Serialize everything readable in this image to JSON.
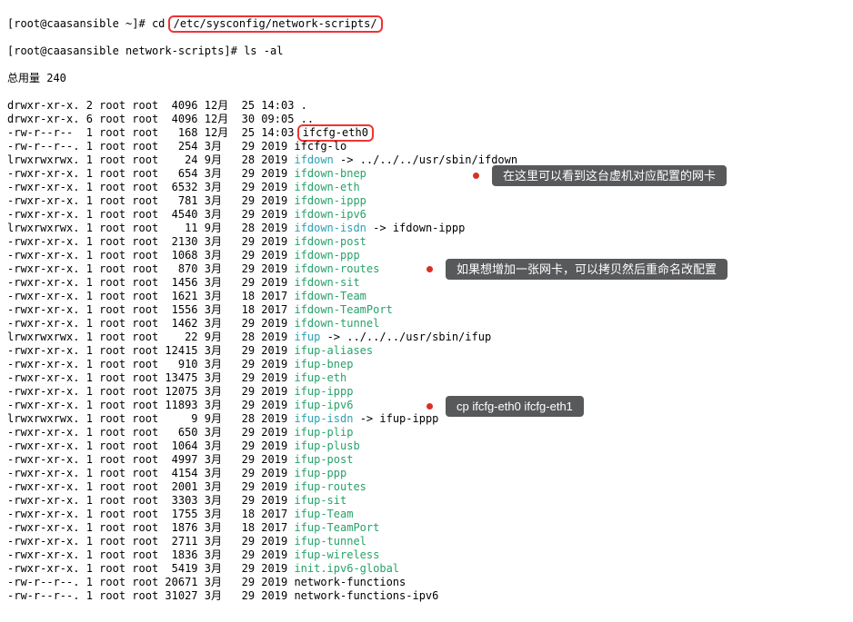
{
  "prompt1_a": "[root@caasansible ~]# cd ",
  "prompt1_b": "/etc/sysconfig/network-scripts/",
  "prompt2": "[root@caasansible network-scripts]# ls -al",
  "total": "总用量 240",
  "rows": [
    {
      "p": "drwxr-xr-x. 2 root root  4096 12月  25 14:03 ",
      "n": ".",
      "c": ""
    },
    {
      "p": "drwxr-xr-x. 6 root root  4096 12月  30 09:05 ",
      "n": "..",
      "c": "",
      "box": true,
      "boxn": "ifcfg-eth0",
      "boxrow": "-rw-r--r--  1 root root   168 12月  25 14:03 "
    },
    {
      "p": "-rw-r--r--. 1 root root   254 3月   29 2019 ",
      "n": "ifcfg-lo",
      "c": ""
    },
    {
      "p": "lrwxrwxrwx. 1 root root    24 9月   28 2019 ",
      "n": "ifdown",
      "c": "cyan",
      "suf": " -> ../../../usr/sbin/ifdown"
    },
    {
      "p": "-rwxr-xr-x. 1 root root   654 3月   29 2019 ",
      "n": "ifdown-bnep",
      "c": "green"
    },
    {
      "p": "-rwxr-xr-x. 1 root root  6532 3月   29 2019 ",
      "n": "ifdown-eth",
      "c": "green"
    },
    {
      "p": "-rwxr-xr-x. 1 root root   781 3月   29 2019 ",
      "n": "ifdown-ippp",
      "c": "green"
    },
    {
      "p": "-rwxr-xr-x. 1 root root  4540 3月   29 2019 ",
      "n": "ifdown-ipv6",
      "c": "green"
    },
    {
      "p": "lrwxrwxrwx. 1 root root    11 9月   28 2019 ",
      "n": "ifdown-isdn",
      "c": "cyan",
      "suf": " -> ifdown-ippp"
    },
    {
      "p": "-rwxr-xr-x. 1 root root  2130 3月   29 2019 ",
      "n": "ifdown-post",
      "c": "green"
    },
    {
      "p": "-rwxr-xr-x. 1 root root  1068 3月   29 2019 ",
      "n": "ifdown-ppp",
      "c": "green"
    },
    {
      "p": "-rwxr-xr-x. 1 root root   870 3月   29 2019 ",
      "n": "ifdown-routes",
      "c": "green"
    },
    {
      "p": "-rwxr-xr-x. 1 root root  1456 3月   29 2019 ",
      "n": "ifdown-sit",
      "c": "green"
    },
    {
      "p": "-rwxr-xr-x. 1 root root  1621 3月   18 2017 ",
      "n": "ifdown-Team",
      "c": "green"
    },
    {
      "p": "-rwxr-xr-x. 1 root root  1556 3月   18 2017 ",
      "n": "ifdown-TeamPort",
      "c": "green"
    },
    {
      "p": "-rwxr-xr-x. 1 root root  1462 3月   29 2019 ",
      "n": "ifdown-tunnel",
      "c": "green"
    },
    {
      "p": "lrwxrwxrwx. 1 root root    22 9月   28 2019 ",
      "n": "ifup",
      "c": "cyan",
      "suf": " -> ../../../usr/sbin/ifup"
    },
    {
      "p": "-rwxr-xr-x. 1 root root 12415 3月   29 2019 ",
      "n": "ifup-aliases",
      "c": "green"
    },
    {
      "p": "-rwxr-xr-x. 1 root root   910 3月   29 2019 ",
      "n": "ifup-bnep",
      "c": "green"
    },
    {
      "p": "-rwxr-xr-x. 1 root root 13475 3月   29 2019 ",
      "n": "ifup-eth",
      "c": "green"
    },
    {
      "p": "-rwxr-xr-x. 1 root root 12075 3月   29 2019 ",
      "n": "ifup-ippp",
      "c": "green"
    },
    {
      "p": "-rwxr-xr-x. 1 root root 11893 3月   29 2019 ",
      "n": "ifup-ipv6",
      "c": "green"
    },
    {
      "p": "lrwxrwxrwx. 1 root root     9 9月   28 2019 ",
      "n": "ifup-isdn",
      "c": "cyan",
      "suf": " -> ifup-ippp"
    },
    {
      "p": "-rwxr-xr-x. 1 root root   650 3月   29 2019 ",
      "n": "ifup-plip",
      "c": "green"
    },
    {
      "p": "-rwxr-xr-x. 1 root root  1064 3月   29 2019 ",
      "n": "ifup-plusb",
      "c": "green"
    },
    {
      "p": "-rwxr-xr-x. 1 root root  4997 3月   29 2019 ",
      "n": "ifup-post",
      "c": "green"
    },
    {
      "p": "-rwxr-xr-x. 1 root root  4154 3月   29 2019 ",
      "n": "ifup-ppp",
      "c": "green"
    },
    {
      "p": "-rwxr-xr-x. 1 root root  2001 3月   29 2019 ",
      "n": "ifup-routes",
      "c": "green"
    },
    {
      "p": "-rwxr-xr-x. 1 root root  3303 3月   29 2019 ",
      "n": "ifup-sit",
      "c": "green"
    },
    {
      "p": "-rwxr-xr-x. 1 root root  1755 3月   18 2017 ",
      "n": "ifup-Team",
      "c": "green"
    },
    {
      "p": "-rwxr-xr-x. 1 root root  1876 3月   18 2017 ",
      "n": "ifup-TeamPort",
      "c": "green"
    },
    {
      "p": "-rwxr-xr-x. 1 root root  2711 3月   29 2019 ",
      "n": "ifup-tunnel",
      "c": "green"
    },
    {
      "p": "-rwxr-xr-x. 1 root root  1836 3月   29 2019 ",
      "n": "ifup-wireless",
      "c": "green"
    },
    {
      "p": "-rwxr-xr-x. 1 root root  5419 3月   29 2019 ",
      "n": "init.ipv6-global",
      "c": "green"
    },
    {
      "p": "-rw-r--r--. 1 root root 20671 3月   29 2019 ",
      "n": "network-functions",
      "c": ""
    },
    {
      "p": "-rw-r--r--. 1 root root 31027 3月   29 2019 ",
      "n": "network-functions-ipv6",
      "c": ""
    }
  ],
  "anno1": "在这里可以看到这台虚机对应配置的网卡",
  "anno2": "如果想增加一张网卡，可以拷贝然后重命名改配置",
  "anno3": "cp ifcfg-eth0 ifcfg-eth1"
}
